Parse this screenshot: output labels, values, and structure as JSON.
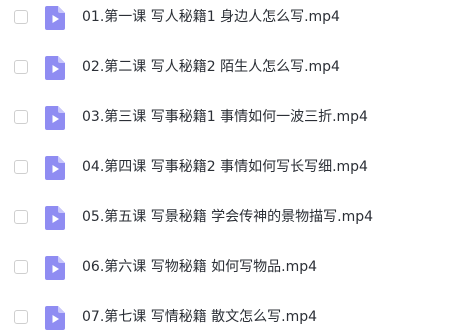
{
  "files": [
    {
      "name": "01.第一课 写人秘籍1 身边人怎么写.mp4",
      "icon": "video-file-icon"
    },
    {
      "name": "02.第二课 写人秘籍2 陌生人怎么写.mp4",
      "icon": "video-file-icon"
    },
    {
      "name": "03.第三课 写事秘籍1 事情如何一波三折.mp4",
      "icon": "video-file-icon"
    },
    {
      "name": "04.第四课 写事秘籍2 事情如何写长写细.mp4",
      "icon": "video-file-icon"
    },
    {
      "name": "05.第五课 写景秘籍 学会传神的景物描写.mp4",
      "icon": "video-file-icon"
    },
    {
      "name": "06.第六课 写物秘籍 如何写物品.mp4",
      "icon": "video-file-icon"
    },
    {
      "name": "07.第七课 写情秘籍 散文怎么写.mp4",
      "icon": "video-file-icon"
    }
  ],
  "colors": {
    "icon_fill": "#8f8cf2",
    "icon_fold": "#c9c7fb",
    "checkbox_border": "#cfcfcf",
    "text": "#2b2f36"
  }
}
